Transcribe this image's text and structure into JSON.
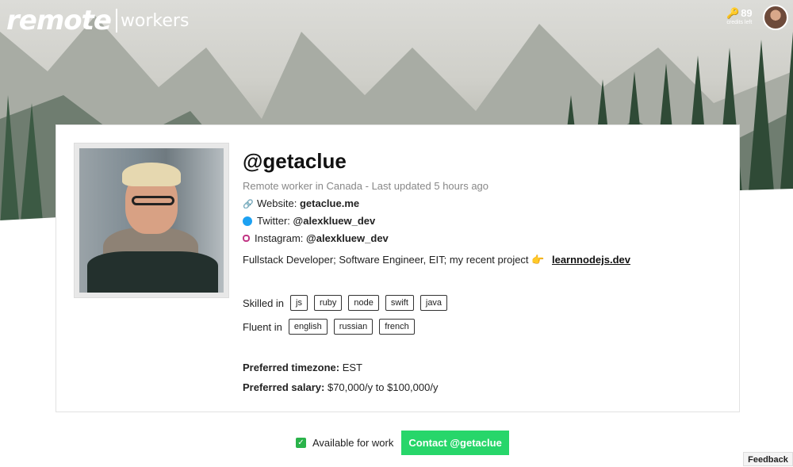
{
  "header": {
    "logo_left": "remote",
    "logo_right": "workers",
    "credits_count": "89",
    "credits_label": "credits left"
  },
  "profile": {
    "handle": "@getaclue",
    "meta": "Remote worker in Canada - Last updated 5 hours ago",
    "website_label": "Website:",
    "website_value": "getaclue.me",
    "twitter_label": "Twitter:",
    "twitter_value": "@alexkluew_dev",
    "instagram_label": "Instagram:",
    "instagram_value": "@alexkluew_dev",
    "bio": "Fullstack Developer; Software Engineer, EIT; my recent project 👉",
    "bio_link": "learnnodejs.dev",
    "skills_label": "Skilled in",
    "skills": [
      "js",
      "ruby",
      "node",
      "swift",
      "java"
    ],
    "langs_label": "Fluent in",
    "langs": [
      "english",
      "russian",
      "french"
    ],
    "timezone_label": "Preferred timezone:",
    "timezone_value": "EST",
    "salary_label": "Preferred salary:",
    "salary_value": "$70,000/y to $100,000/y"
  },
  "footer": {
    "available_label": "Available for work",
    "contact_button": "Contact @getaclue",
    "feedback": "Feedback"
  },
  "colors": {
    "accent_green": "#27d66a",
    "twitter_blue": "#1da1f2"
  }
}
